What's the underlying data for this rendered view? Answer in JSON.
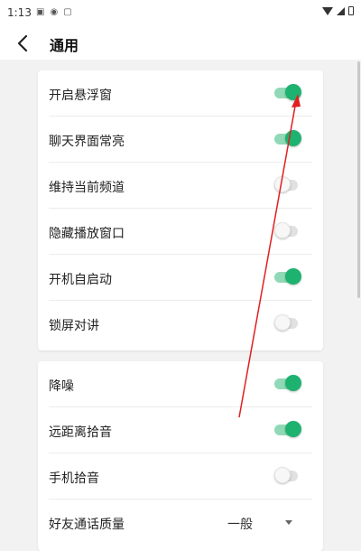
{
  "status_bar": {
    "time": "1:13",
    "left_icons": [
      "image-icon",
      "radio-icon",
      "notification-icon"
    ],
    "right_icons": [
      "wifi-icon",
      "cellular-icon",
      "battery-icon"
    ]
  },
  "header": {
    "title": "通用",
    "back_icon": "chevron-left-icon"
  },
  "settings_group_1": [
    {
      "label": "开启悬浮窗",
      "value": "on"
    },
    {
      "label": "聊天界面常亮",
      "value": "on"
    },
    {
      "label": "维持当前频道",
      "value": "off"
    },
    {
      "label": "隐藏播放窗口",
      "value": "off"
    },
    {
      "label": "开机自启动",
      "value": "on"
    },
    {
      "label": "锁屏对讲",
      "value": "off"
    }
  ],
  "settings_group_2": [
    {
      "label": "降噪",
      "value": "on"
    },
    {
      "label": "远距离拾音",
      "value": "on"
    },
    {
      "label": "手机拾音",
      "value": "off"
    },
    {
      "label": "好友通话质量",
      "value": "一般"
    }
  ],
  "colors": {
    "accent": "#1db26f",
    "accent_track": "#8fd9b6",
    "annotation_arrow": "#e02020"
  }
}
